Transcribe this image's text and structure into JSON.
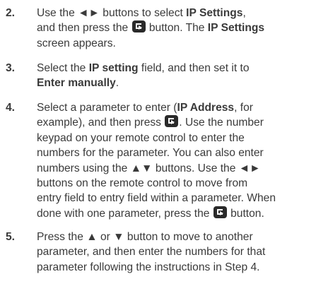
{
  "steps": [
    {
      "number": "2.",
      "lines": [
        [
          "Use the ◄► buttons to select ",
          {
            "b": "IP Settings"
          },
          ","
        ],
        [
          "and then press the ",
          {
            "icon": "enter"
          },
          " button. The ",
          {
            "b": "IP Settings"
          }
        ],
        [
          "screen appears."
        ]
      ]
    },
    {
      "number": "3.",
      "lines": [
        [
          "Select the ",
          {
            "b": "IP setting"
          },
          " field, and then set it to"
        ],
        [
          {
            "b": "Enter manually"
          },
          "."
        ]
      ]
    },
    {
      "number": "4.",
      "lines": [
        [
          "Select a parameter to enter (",
          {
            "b": "IP Address"
          },
          ", for"
        ],
        [
          "example), and then press ",
          {
            "icon": "enter"
          },
          ". Use the number"
        ],
        [
          "keypad on your remote control to enter the"
        ],
        [
          "numbers for the parameter. You can also enter"
        ],
        [
          "numbers using the ▲▼ buttons. Use the ◄►"
        ],
        [
          "buttons on the remote control to move from"
        ],
        [
          "entry field to entry field within a parameter. When"
        ],
        [
          "done with one parameter, press the ",
          {
            "icon": "enter"
          },
          " button."
        ]
      ]
    },
    {
      "number": "5.",
      "lines": [
        [
          "Press the ▲ or ▼ button to move to another"
        ],
        [
          "parameter, and then enter the numbers for that"
        ],
        [
          "parameter following the instructions in Step 4."
        ]
      ]
    }
  ]
}
